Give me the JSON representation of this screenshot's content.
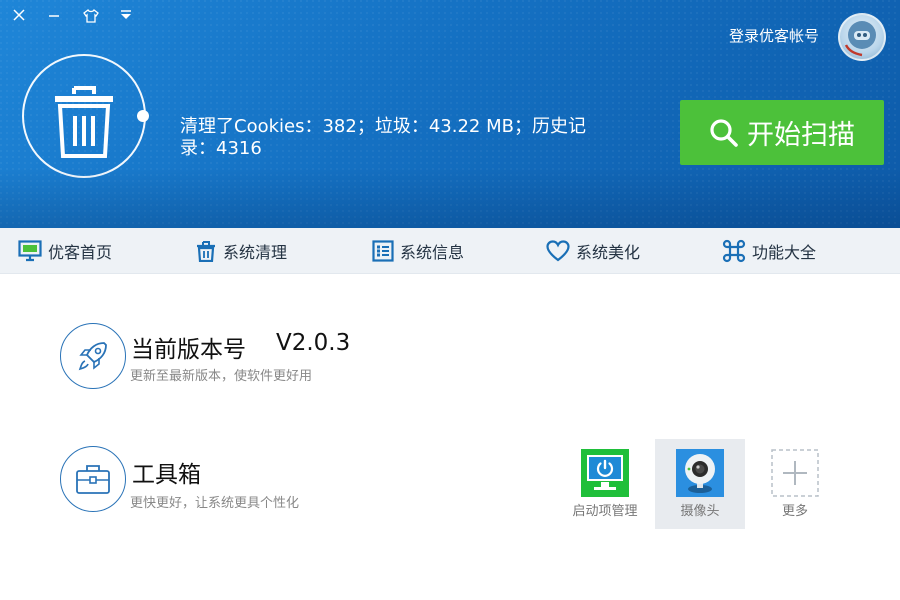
{
  "header": {
    "login_label": "登录优客帐号",
    "stats_text": "清理了Cookies：382；垃圾：43.22 MB；历史记录：4316",
    "scan_button_label": "开始扫描"
  },
  "nav": {
    "items": [
      {
        "label": "优客首页",
        "icon": "monitor-icon"
      },
      {
        "label": "系统清理",
        "icon": "trash-icon"
      },
      {
        "label": "系统信息",
        "icon": "list-icon"
      },
      {
        "label": "系统美化",
        "icon": "heart-icon"
      },
      {
        "label": "功能大全",
        "icon": "command-icon"
      }
    ]
  },
  "version_section": {
    "title": "当前版本号",
    "version": "V2.0.3",
    "subtitle": "更新至最新版本，使软件更好用",
    "icon": "rocket-icon"
  },
  "toolbox_section": {
    "title": "工具箱",
    "subtitle": "更快更好，让系统更具个性化",
    "icon": "toolbox-icon",
    "tools": [
      {
        "label": "启动项管理",
        "icon": "power-monitor-icon",
        "selected": false
      },
      {
        "label": "摄像头",
        "icon": "webcam-icon",
        "selected": true
      },
      {
        "label": "更多",
        "icon": "plus-icon",
        "selected": false
      }
    ]
  },
  "colors": {
    "header_blue": "#1470c2",
    "scan_green": "#4cc13a",
    "accent_blue": "#2a73b7"
  }
}
